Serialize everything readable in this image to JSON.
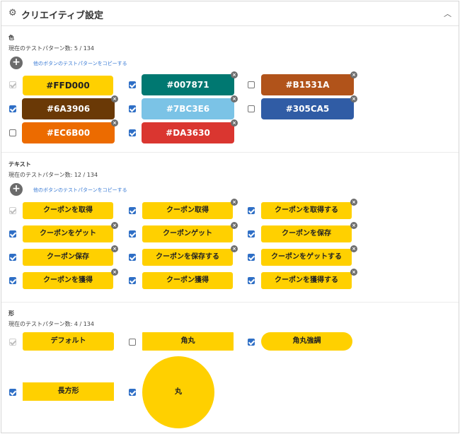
{
  "header": {
    "title": "クリエイティブ設定",
    "gear_icon": "gear-icon",
    "collapse_icon": "chevron-up-icon"
  },
  "color_section": {
    "title": "色",
    "count": "現在のテストパターン数: 5 / 134",
    "copy_link": "他のボタンのテストパターンをコピーする",
    "items": [
      {
        "label": "#FFD000",
        "bg": "#FFD000",
        "text": "#222222"
      },
      {
        "label": "#007871",
        "bg": "#007871",
        "text": "#ffffff"
      },
      {
        "label": "#B1531A",
        "bg": "#B1531A",
        "text": "#ffffff"
      },
      {
        "label": "#6A3906",
        "bg": "#6A3906",
        "text": "#ffffff"
      },
      {
        "label": "#7BC3E6",
        "bg": "#7BC3E6",
        "text": "#ffffff"
      },
      {
        "label": "#305CA5",
        "bg": "#305CA5",
        "text": "#ffffff"
      },
      {
        "label": "#EC6B00",
        "bg": "#EC6B00",
        "text": "#ffffff"
      },
      {
        "label": "#DA3630",
        "bg": "#DA3630",
        "text": "#ffffff"
      }
    ]
  },
  "text_section": {
    "title": "テキスト",
    "count": "現在のテストパターン数: 12 / 134",
    "copy_link": "他のボタンのテストパターンをコピーする",
    "items": [
      {
        "label": "クーポンを取得"
      },
      {
        "label": "クーポン取得"
      },
      {
        "label": "クーポンを取得する"
      },
      {
        "label": "クーポンをゲット"
      },
      {
        "label": "クーポンゲット"
      },
      {
        "label": "クーポンを保存"
      },
      {
        "label": "クーポン保存"
      },
      {
        "label": "クーポンを保存する"
      },
      {
        "label": "クーポンをゲットする"
      },
      {
        "label": "クーポンを獲得"
      },
      {
        "label": "クーポン獲得"
      },
      {
        "label": "クーポンを獲得する"
      }
    ]
  },
  "shape_section": {
    "title": "形",
    "count": "現在のテストパターン数: 4 / 134",
    "items": [
      {
        "label": "デフォルト"
      },
      {
        "label": "角丸"
      },
      {
        "label": "角丸強調"
      },
      {
        "label": "長方形"
      },
      {
        "label": "丸"
      }
    ]
  },
  "colors": {
    "button_yellow": "#FFD000",
    "checkbox_blue": "#2f6fc6",
    "link_blue": "#3a7bd5"
  }
}
